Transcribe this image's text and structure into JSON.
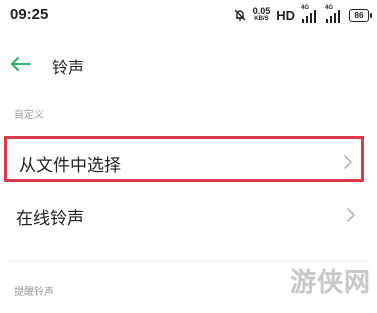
{
  "status_bar": {
    "time": "09:25",
    "speed_value": "0.05",
    "speed_unit": "KB/S",
    "hd": "HD",
    "sim1_label": "4G",
    "sim2_label": "4G",
    "battery": "86"
  },
  "header": {
    "title": "铃声"
  },
  "sections": {
    "custom_label": "自定义",
    "notify_label": "提醒铃声"
  },
  "rows": [
    {
      "label": "从文件中选择"
    },
    {
      "label": "在线铃声"
    }
  ],
  "watermark": "游侠网",
  "colors": {
    "accent_green": "#2db56b",
    "highlight_red": "#d9394a"
  }
}
